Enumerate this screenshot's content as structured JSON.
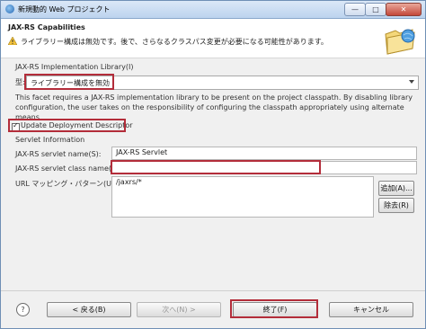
{
  "window": {
    "title": "新規動的 Web プロジェクト"
  },
  "header": {
    "title": "JAX-RS Capabilities",
    "message": "ライブラリー構成は無効です。後で、さらなるクラスパス変更が必要になる可能性があります。"
  },
  "library": {
    "section_label": "JAX-RS Implementation Library(I)",
    "type_label": "型:",
    "type_value": "ライブラリー構成を無効",
    "description": "This facet requires a JAX-RS implementation library to be present on the project classpath. By disabling library configuration, the user takes on the responsibility of configuring the classpath appropriately using alternate means."
  },
  "update_descriptor": {
    "label": "Update Deployment Descriptor",
    "checked": true
  },
  "servlet": {
    "section_label": "Servlet Information",
    "name_label": "JAX-RS servlet name(S):",
    "name_value": "JAX-RS Servlet",
    "class_label": "JAX-RS servlet class name(L):",
    "class_value": "",
    "url_label": "URL マッピング・パターン(U):",
    "url_value": "/jaxrs/*",
    "add_button": "追加(A)...",
    "remove_button": "除去(R)"
  },
  "footer": {
    "back": "< 戻る(B)",
    "next": "次へ(N) >",
    "finish": "終了(F)",
    "cancel": "キャンセル",
    "help_icon": "?"
  },
  "colors": {
    "highlight": "#b32d3a",
    "title_bar": "#bcd3ee"
  }
}
